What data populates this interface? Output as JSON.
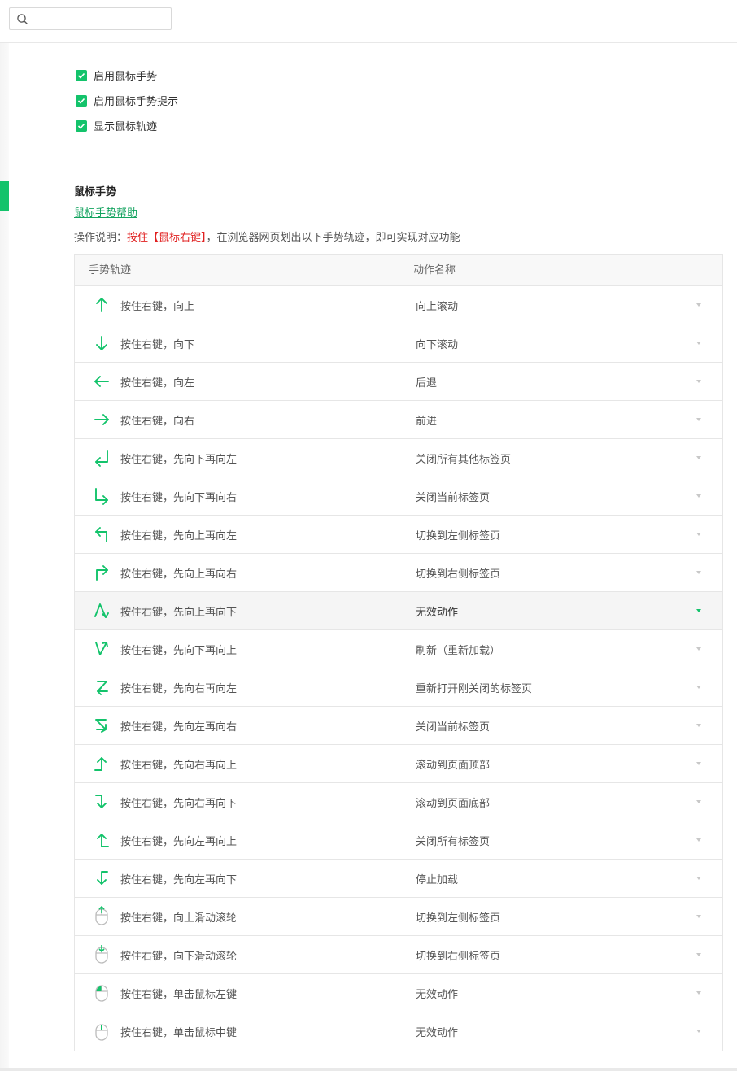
{
  "search": {
    "placeholder": ""
  },
  "settings": [
    {
      "label": "启用鼠标手势",
      "checked": true
    },
    {
      "label": "启用鼠标手势提示",
      "checked": true
    },
    {
      "label": "显示鼠标轨迹",
      "checked": true
    }
  ],
  "section": {
    "title": "鼠标手势",
    "help_link": "鼠标手势帮助",
    "desc_prefix": "操作说明：",
    "desc_highlight": "按住【鼠标右键】",
    "desc_suffix": "，在浏览器网页划出以下手势轨迹，即可实现对应功能"
  },
  "table": {
    "col_gesture": "手势轨迹",
    "col_action": "动作名称",
    "rows": [
      {
        "icon": "arrow-up-icon",
        "gesture": "按住右键，向上",
        "action": "向上滚动"
      },
      {
        "icon": "arrow-down-icon",
        "gesture": "按住右键，向下",
        "action": "向下滚动"
      },
      {
        "icon": "arrow-left-icon",
        "gesture": "按住右键，向左",
        "action": "后退"
      },
      {
        "icon": "arrow-right-icon",
        "gesture": "按住右键，向右",
        "action": "前进"
      },
      {
        "icon": "down-left-icon",
        "gesture": "按住右键，先向下再向左",
        "action": "关闭所有其他标签页"
      },
      {
        "icon": "down-right-icon",
        "gesture": "按住右键，先向下再向右",
        "action": "关闭当前标签页"
      },
      {
        "icon": "up-left-icon",
        "gesture": "按住右键，先向上再向左",
        "action": "切换到左侧标签页"
      },
      {
        "icon": "up-right-icon",
        "gesture": "按住右键，先向上再向右",
        "action": "切换到右侧标签页"
      },
      {
        "icon": "up-down-icon",
        "gesture": "按住右键，先向上再向下",
        "action": "无效动作"
      },
      {
        "icon": "down-up-icon",
        "gesture": "按住右键，先向下再向上",
        "action": "刷新（重新加载）"
      },
      {
        "icon": "right-left-icon",
        "gesture": "按住右键，先向右再向左",
        "action": "重新打开刚关闭的标签页"
      },
      {
        "icon": "left-right-icon",
        "gesture": "按住右键，先向左再向右",
        "action": "关闭当前标签页"
      },
      {
        "icon": "right-up-icon",
        "gesture": "按住右键，先向右再向上",
        "action": "滚动到页面顶部"
      },
      {
        "icon": "right-down-icon",
        "gesture": "按住右键，先向右再向下",
        "action": "滚动到页面底部"
      },
      {
        "icon": "left-up-icon",
        "gesture": "按住右键，先向左再向上",
        "action": "关闭所有标签页"
      },
      {
        "icon": "left-down-icon",
        "gesture": "按住右键，先向左再向下",
        "action": "停止加载"
      },
      {
        "icon": "wheel-up-icon",
        "gesture": "按住右键，向上滑动滚轮",
        "action": "切换到左侧标签页"
      },
      {
        "icon": "wheel-down-icon",
        "gesture": "按住右键，向下滑动滚轮",
        "action": "切换到右侧标签页"
      },
      {
        "icon": "mouse-left-click-icon",
        "gesture": "按住右键，单击鼠标左键",
        "action": "无效动作"
      },
      {
        "icon": "mouse-middle-click-icon",
        "gesture": "按住右键，单击鼠标中键",
        "action": "无效动作"
      }
    ]
  },
  "colors": {
    "accent": "#13c36b",
    "link": "#13a35f",
    "highlight": "#e02020"
  }
}
